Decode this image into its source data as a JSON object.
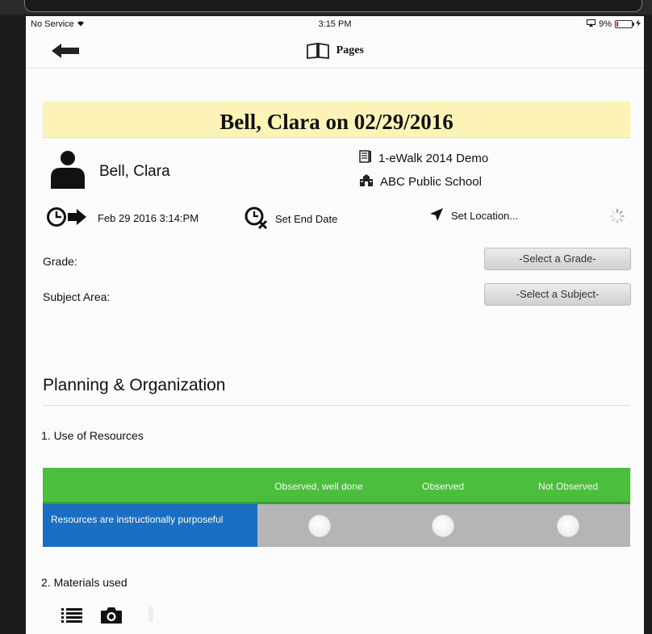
{
  "status_bar": {
    "carrier": "No Service",
    "time": "3:15 PM",
    "battery": "9%"
  },
  "nav": {
    "title": "Pages"
  },
  "observation": {
    "title": "Bell, Clara on 02/29/2016",
    "teacher_name": "Bell, Clara",
    "template": "1-eWalk 2014 Demo",
    "school": "ABC Public School",
    "start_time": "Feb 29 2016 3:14:PM",
    "end_date_label": "Set End Date",
    "location_label": "Set Location..."
  },
  "fields": {
    "grade_label": "Grade:",
    "grade_select": "-Select a Grade-",
    "subject_label": "Subject Area:",
    "subject_select": "-Select a Subject-"
  },
  "section": {
    "title": "Planning & Organization",
    "question1": "1. Use of Resources",
    "question2": "2. Materials used"
  },
  "rubric": {
    "columns": [
      "Observed, well done",
      "Observed",
      "Not Observed"
    ],
    "row_label": "Resources are instructionally purposeful"
  },
  "colors": {
    "banner": "#fbf4b6",
    "rubric_header": "#4cbe3e",
    "row_label": "#1a6ec4",
    "row_bg": "#b5b5b5"
  },
  "icons": {
    "back": "back-arrow-icon",
    "pages": "book-icon",
    "teacher": "person-icon",
    "template": "document-icon",
    "school": "school-building-icon",
    "start": "clock-arrow-icon",
    "end": "clock-cancel-icon",
    "location": "location-arrow-icon",
    "loading": "spinner-icon",
    "list": "list-icon",
    "camera": "camera-icon"
  }
}
